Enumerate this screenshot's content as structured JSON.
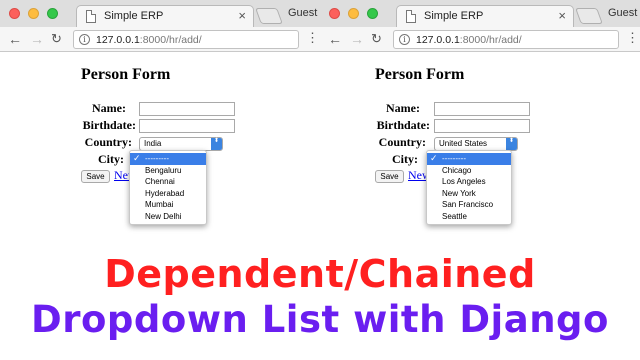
{
  "windows": [
    {
      "tab_title": "Simple ERP",
      "tab_close": "×",
      "profile_label": "Guest",
      "url_host": "127.0.0.1",
      "url_path": ":8000/hr/add/",
      "form_title": "Person Form",
      "labels": {
        "name": "Name:",
        "birthdate": "Birthdate:",
        "country": "Country:",
        "city": "City:"
      },
      "country_value": "India",
      "save_label": "Save",
      "new_link": "New",
      "city_options": [
        "---------",
        "Bengaluru",
        "Chennai",
        "Hyderabad",
        "Mumbai",
        "New Delhi"
      ]
    },
    {
      "tab_title": "Simple ERP",
      "tab_close": "×",
      "profile_label": "Guest",
      "url_host": "127.0.0.1",
      "url_path": ":8000/hr/add/",
      "form_title": "Person Form",
      "labels": {
        "name": "Name:",
        "birthdate": "Birthdate:",
        "country": "Country:",
        "city": "City:"
      },
      "country_value": "United States",
      "save_label": "Save",
      "new_link": "New",
      "city_options": [
        "---------",
        "Chicago",
        "Los Angeles",
        "New York",
        "San Francisco",
        "Seattle"
      ]
    }
  ],
  "icons": {
    "back": "←",
    "forward": "→",
    "reload": "↻",
    "info": "i",
    "menu": "⋮",
    "check": "✓",
    "select_arrow": "⬍"
  },
  "colors": {
    "selected_option": "#3a7ee8",
    "caption_line1": "#ff2020",
    "caption_line2": "#6a1ef0",
    "link": "#0000ee"
  },
  "caption": {
    "line1": "Dependent/Chained",
    "line2": "Dropdown List with Django"
  }
}
